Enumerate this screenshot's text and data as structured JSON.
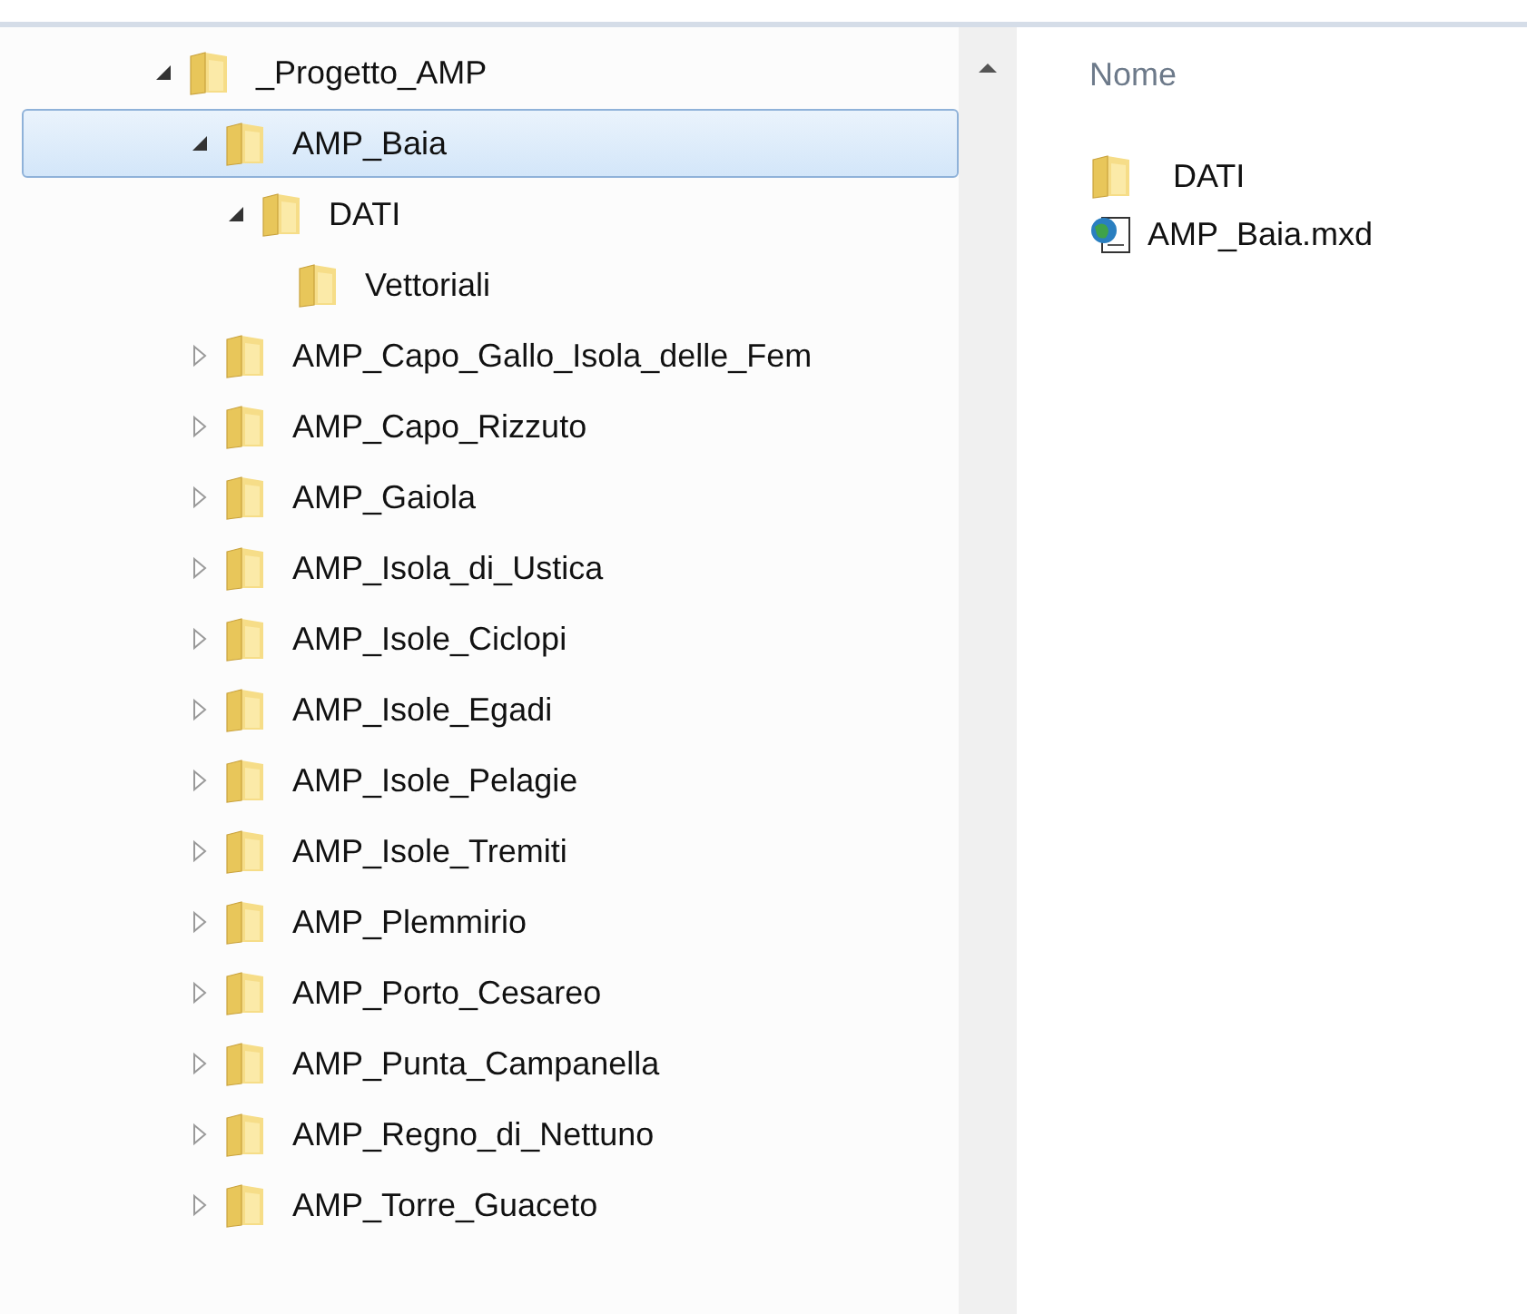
{
  "tree": [
    {
      "label": "_Progetto_AMP",
      "expanded": true,
      "selected": false,
      "children": [
        {
          "label": "AMP_Baia",
          "expanded": true,
          "selected": true,
          "children": [
            {
              "label": "DATI",
              "expanded": true,
              "selected": false,
              "children": [
                {
                  "label": "Vettoriali",
                  "selected": false
                }
              ]
            }
          ]
        },
        {
          "label": "AMP_Capo_Gallo_Isola_delle_Fem",
          "expanded": false,
          "selected": false
        },
        {
          "label": "AMP_Capo_Rizzuto",
          "expanded": false,
          "selected": false
        },
        {
          "label": "AMP_Gaiola",
          "expanded": false,
          "selected": false
        },
        {
          "label": "AMP_Isola_di_Ustica",
          "expanded": false,
          "selected": false
        },
        {
          "label": "AMP_Isole_Ciclopi",
          "expanded": false,
          "selected": false
        },
        {
          "label": "AMP_Isole_Egadi",
          "expanded": false,
          "selected": false
        },
        {
          "label": "AMP_Isole_Pelagie",
          "expanded": false,
          "selected": false
        },
        {
          "label": "AMP_Isole_Tremiti",
          "expanded": false,
          "selected": false
        },
        {
          "label": "AMP_Plemmirio",
          "expanded": false,
          "selected": false
        },
        {
          "label": "AMP_Porto_Cesareo",
          "expanded": false,
          "selected": false
        },
        {
          "label": "AMP_Punta_Campanella",
          "expanded": false,
          "selected": false
        },
        {
          "label": "AMP_Regno_di_Nettuno",
          "expanded": false,
          "selected": false
        },
        {
          "label": "AMP_Torre_Guaceto",
          "expanded": false,
          "selected": false
        }
      ]
    }
  ],
  "file_list": {
    "column_header": "Nome",
    "items": [
      {
        "name": "DATI",
        "kind": "folder"
      },
      {
        "name": "AMP_Baia.mxd",
        "kind": "map_document"
      }
    ]
  }
}
